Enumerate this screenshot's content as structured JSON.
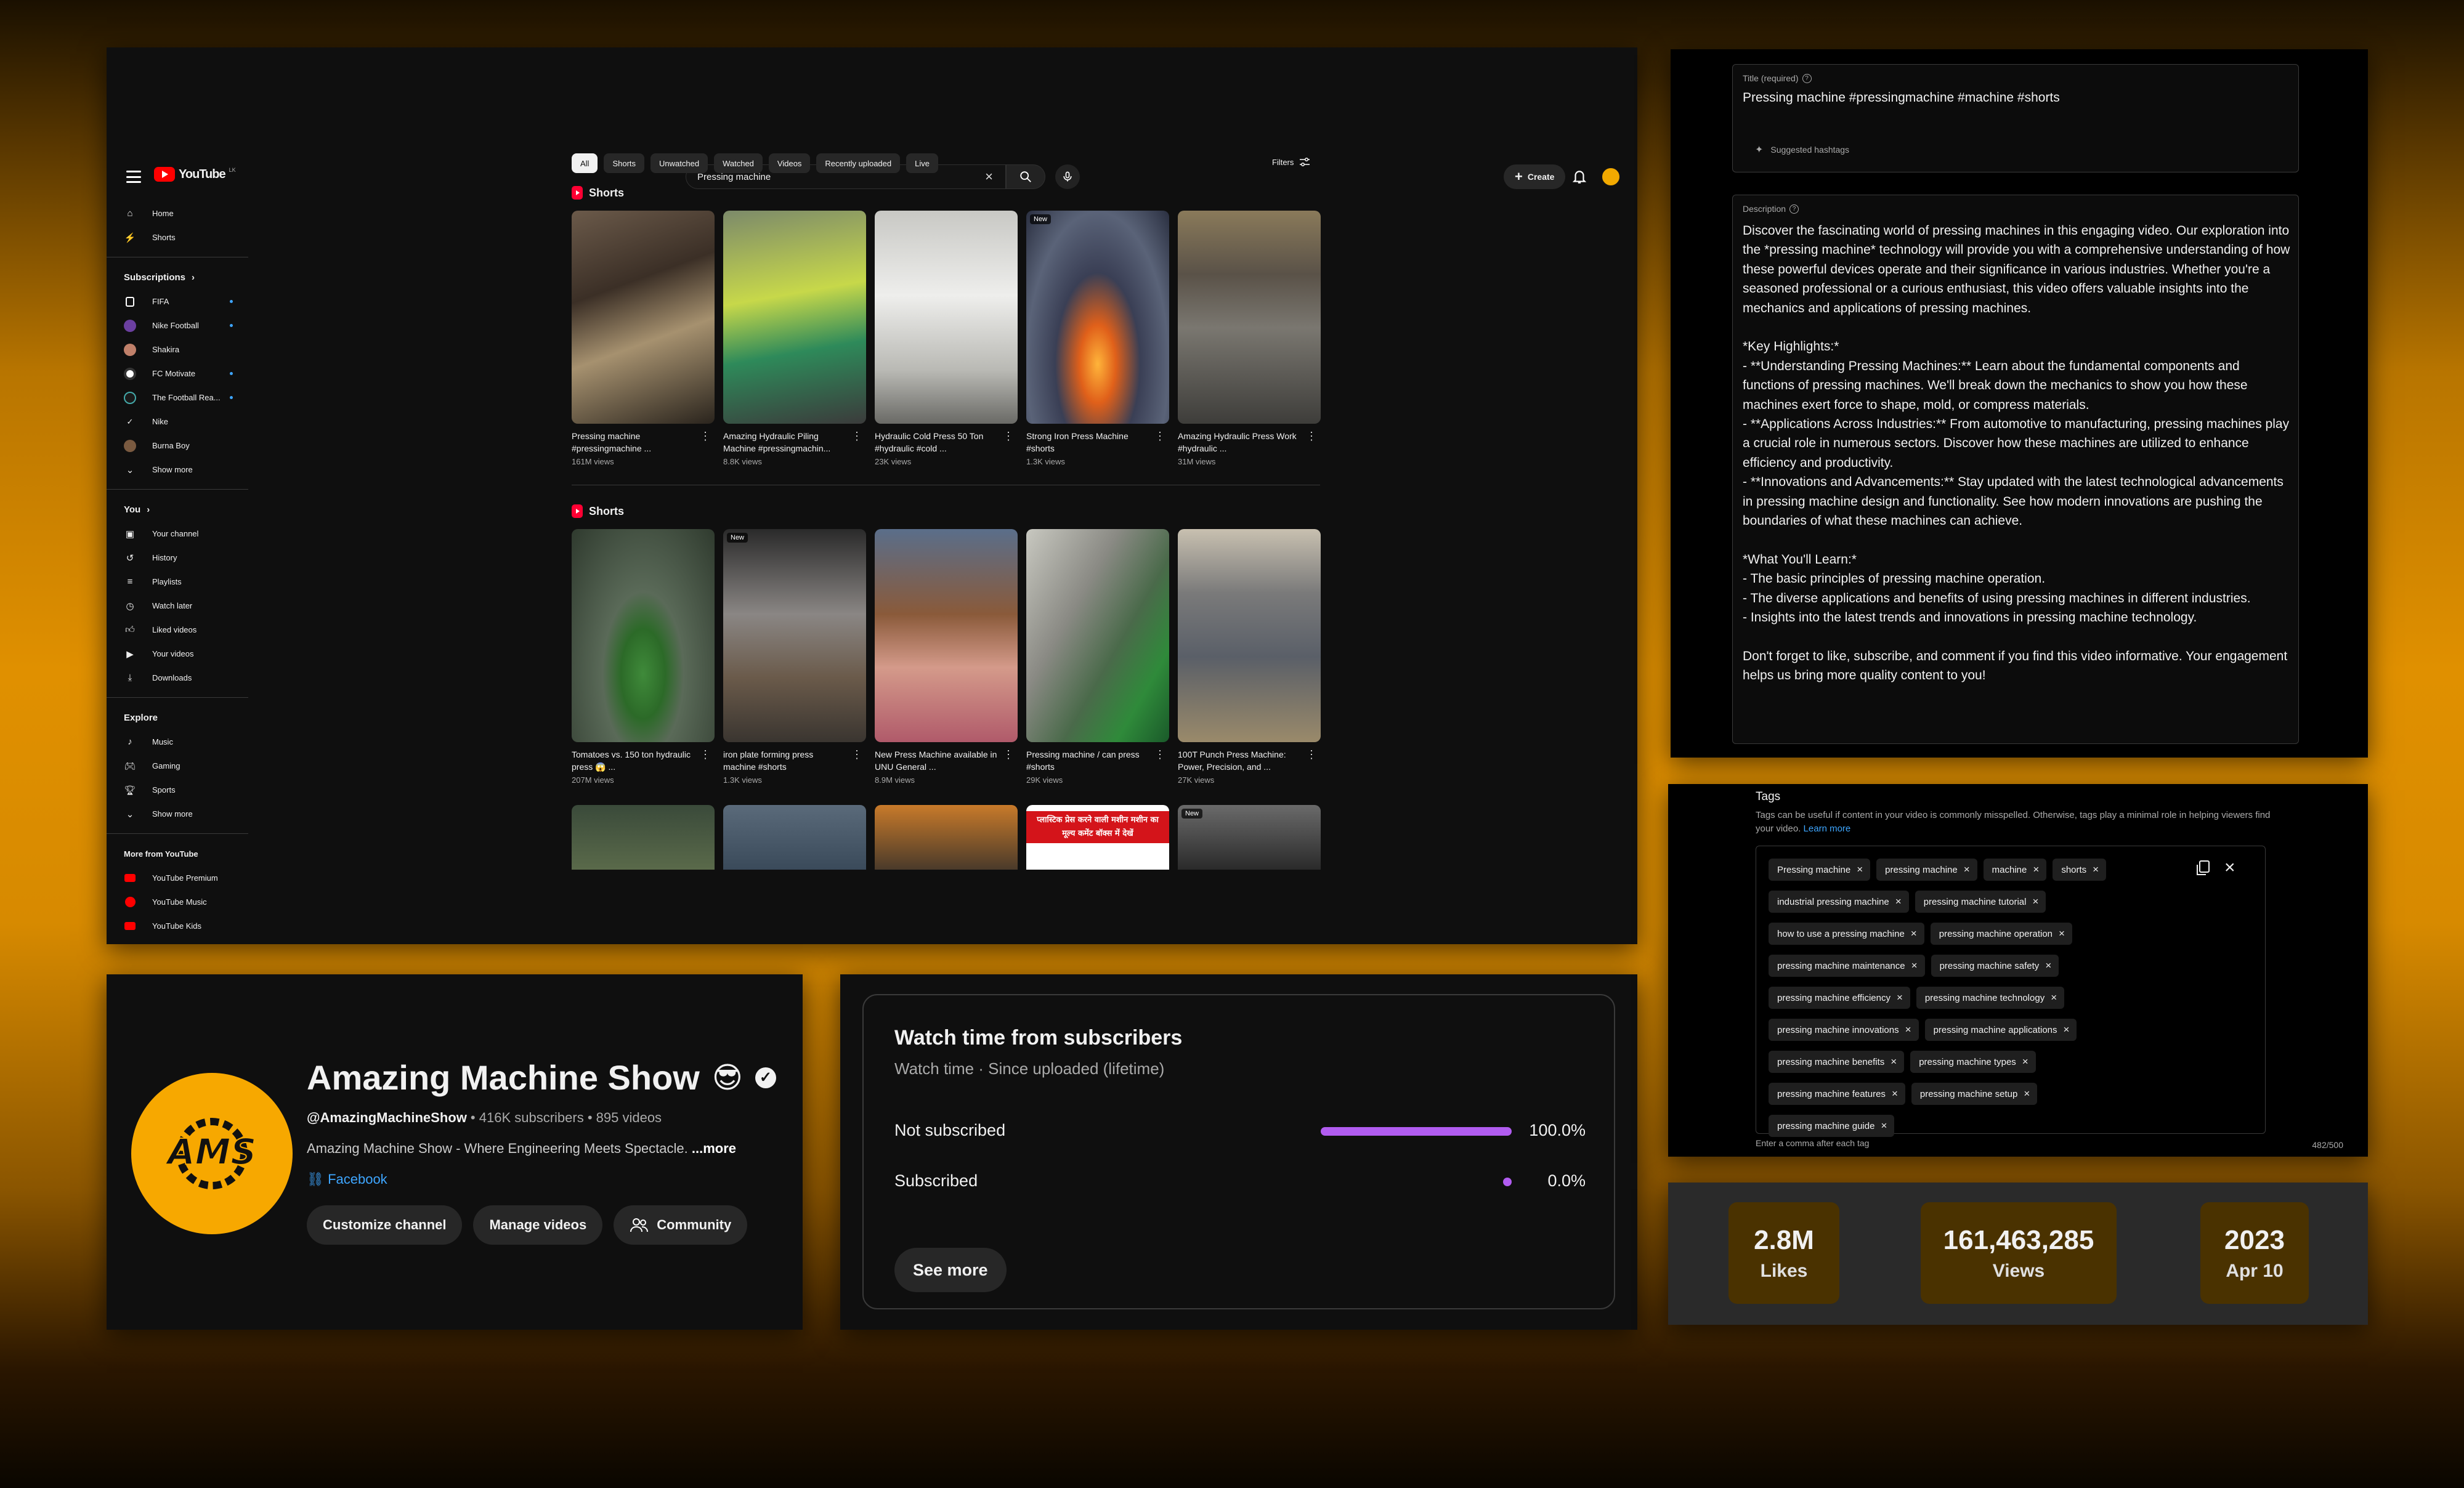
{
  "youtube": {
    "logo_text": "YouTube",
    "logo_country": "LK",
    "search_value": "Pressing machine",
    "create_label": "Create",
    "chips": [
      "All",
      "Shorts",
      "Unwatched",
      "Watched",
      "Videos",
      "Recently uploaded",
      "Live"
    ],
    "filters_label": "Filters",
    "sidebar": {
      "home": "Home",
      "shorts": "Shorts",
      "subscriptions_head": "Subscriptions",
      "subscriptions": [
        "FIFA",
        "Nike Football",
        "Shakira",
        "FC Motivate",
        "The Football Rea...",
        "Nike",
        "Burna Boy"
      ],
      "show_more": "Show more",
      "you_head": "You",
      "you_items": [
        "Your channel",
        "History",
        "Playlists",
        "Watch later",
        "Liked videos",
        "Your videos",
        "Downloads"
      ],
      "explore_head": "Explore",
      "explore_items": [
        "Music",
        "Gaming",
        "Sports"
      ],
      "explore_more": "Show more",
      "more_head": "More from YouTube",
      "more_items": [
        "YouTube Premium",
        "YouTube Music",
        "YouTube Kids"
      ]
    },
    "shelves": [
      {
        "title": "Shorts",
        "items": [
          {
            "title": "Pressing machine #pressingmachine ...",
            "views": "161M views",
            "new": ""
          },
          {
            "title": "Amazing Hydraulic Piling Machine #pressingmachin...",
            "views": "8.8K views",
            "new": ""
          },
          {
            "title": "Hydraulic Cold Press 50 Ton #hydraulic #cold ...",
            "views": "23K views",
            "new": ""
          },
          {
            "title": "Strong Iron Press Machine #shorts",
            "views": "1.3K views",
            "new": "New"
          },
          {
            "title": "Amazing Hydraulic Press Work #hydraulic ...",
            "views": "31M views",
            "new": ""
          }
        ]
      },
      {
        "title": "Shorts",
        "items": [
          {
            "title": "Tomatoes vs. 150 ton hydraulic press 😱 ...",
            "views": "207M views",
            "new": ""
          },
          {
            "title": "iron plate forming press machine  #shorts",
            "views": "1.3K views",
            "new": "New"
          },
          {
            "title": "New Press Machine available in UNU General ...",
            "views": "8.9M views",
            "new": ""
          },
          {
            "title": "Pressing machine / can press #shorts",
            "views": "29K views",
            "new": ""
          },
          {
            "title": "100T Punch Press Machine: Power, Precision, and ...",
            "views": "27K views",
            "new": ""
          }
        ]
      }
    ],
    "third_row_badge": "New",
    "third_row_banner": "प्लास्टिक प्रेस करने वाली मशीन मशीन का मूल्य कमेंट बॉक्स में देखें"
  },
  "channel": {
    "name": "Amazing Machine Show",
    "emoji": "😎",
    "handle": "@AmazingMachineShow",
    "meta": " • 416K subscribers • 895 videos",
    "description": "Amazing Machine Show - Where Engineering Meets Spectacle.",
    "more": "...more",
    "link": "Facebook",
    "avatar_text": "AMS",
    "buttons": [
      "Customize channel",
      "Manage videos",
      "Community"
    ]
  },
  "watch_time": {
    "title": "Watch time from subscribers",
    "subtitle": "Watch time · Since uploaded (lifetime)",
    "rows": [
      {
        "label": "Not subscribed",
        "pct_text": "100.0%",
        "fraction": 1.0
      },
      {
        "label": "Subscribed",
        "pct_text": "0.0%",
        "fraction": 0.0
      }
    ],
    "see_more": "See more",
    "accent": "#b15cf0"
  },
  "details": {
    "title_label": "Title (required)",
    "title_value": "Pressing machine #pressingmachine #machine #shorts",
    "suggested_hashtags": "Suggested hashtags",
    "description_label": "Description",
    "description_value": "Discover the fascinating world of pressing machines in this engaging video. Our exploration into the *pressing machine* technology will provide you with a comprehensive understanding of how these powerful devices operate and their significance in various industries. Whether you're a seasoned professional or a curious enthusiast, this video offers valuable insights into the mechanics and applications of pressing machines.\n\n*Key Highlights:*\n- **Understanding Pressing Machines:** Learn about the fundamental components and functions of pressing machines. We'll break down the mechanics to show you how these machines exert force to shape, mold, or compress materials.\n- **Applications Across Industries:** From automotive to manufacturing, pressing machines play a crucial role in numerous sectors. Discover how these machines are utilized to enhance efficiency and productivity.\n- **Innovations and Advancements:** Stay updated with the latest technological advancements in pressing machine design and functionality. See how modern innovations are pushing the boundaries of what these machines can achieve.\n\n*What You'll Learn:*\n- The basic principles of pressing machine operation.\n- The diverse applications and benefits of using pressing machines in different industries.\n- Insights into the latest trends and innovations in pressing machine technology.\n\nDon't forget to like, subscribe, and comment if you find this video informative. Your engagement helps us bring more quality content to you!"
  },
  "tags": {
    "title": "Tags",
    "help": "Tags can be useful if content in your video is commonly misspelled. Otherwise, tags play a minimal role in helping viewers find your video.",
    "learn_more": "Learn more",
    "items": [
      "Pressing machine",
      "pressing machine",
      "machine",
      "shorts",
      "industrial pressing machine",
      "pressing machine tutorial",
      "how to use a pressing machine",
      "pressing machine operation",
      "pressing machine maintenance",
      "pressing machine safety",
      "pressing machine efficiency",
      "pressing machine technology",
      "pressing machine innovations",
      "pressing machine applications",
      "pressing machine benefits",
      "pressing machine types",
      "pressing machine features",
      "pressing machine setup",
      "pressing machine guide"
    ],
    "hint": "Enter a comma after each tag",
    "count": "482/500"
  },
  "stats": [
    {
      "value": "2.8M",
      "label": "Likes"
    },
    {
      "value": "161,463,285",
      "label": "Views"
    },
    {
      "value": "2023",
      "label": "Apr 10"
    }
  ]
}
